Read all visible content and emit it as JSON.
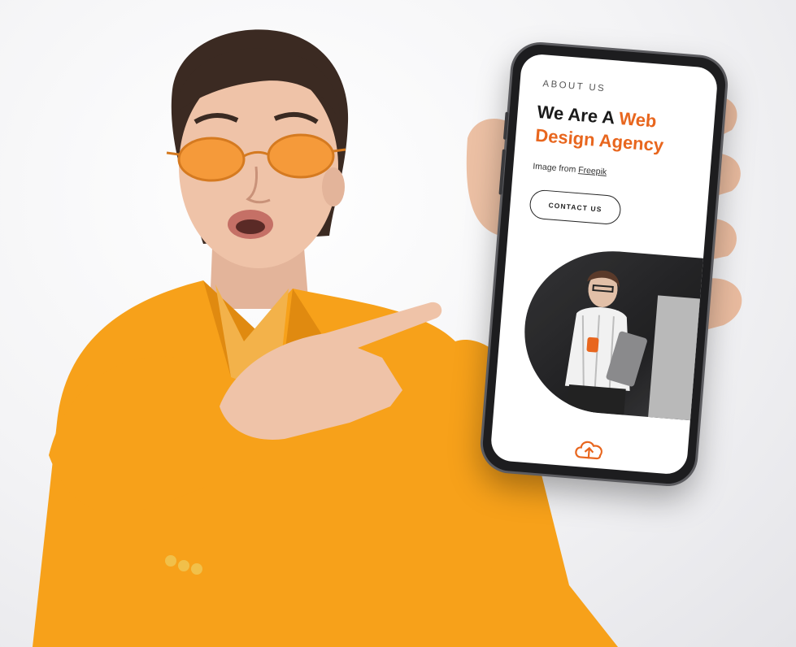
{
  "phone_screen": {
    "section_label": "ABOUT US",
    "headline_part1": "We Are A ",
    "headline_accent1": "Web",
    "headline_accent2": "Design Agency",
    "credit_prefix": "Image from ",
    "credit_link": "Freepik",
    "cta_label": "CONTACT US",
    "accent_color": "#e8661e",
    "bottom_icon": "cloud-upload-icon"
  }
}
